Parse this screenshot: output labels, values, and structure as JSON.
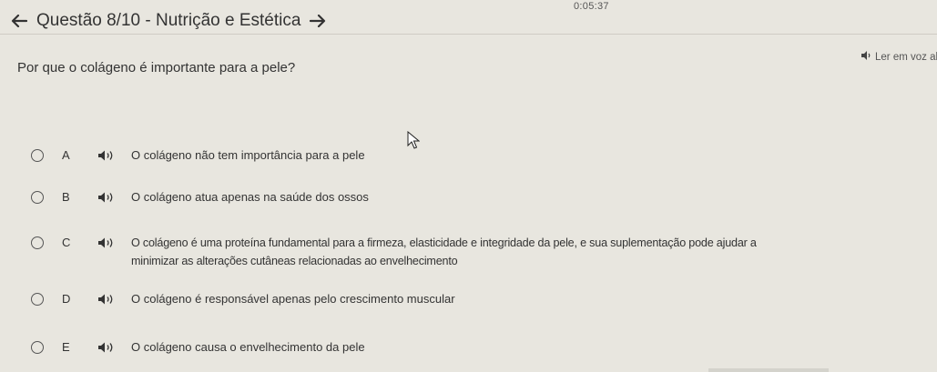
{
  "timer": "0:05:37",
  "header": {
    "title": "Questão 8/10 - Nutrição e Estética",
    "back_icon": "arrow-left-icon",
    "forward_icon": "arrow-right-icon"
  },
  "question": {
    "text": "Por que o colágeno é importante para a pele?"
  },
  "read_aloud": {
    "label": "Ler em voz alta",
    "icon": "speaker-icon"
  },
  "options": [
    {
      "letter": "A",
      "text": "O colágeno não tem importância para a pele"
    },
    {
      "letter": "B",
      "text": "O colágeno atua apenas na saúde dos ossos"
    },
    {
      "letter": "C",
      "text": "O colágeno é uma proteína fundamental para a firmeza, elasticidade e integridade da pele, e sua suplementação pode ajudar a minimizar as alterações cutâneas relacionadas ao envelhecimento"
    },
    {
      "letter": "D",
      "text": "O colágeno é responsável apenas pelo crescimento muscular"
    },
    {
      "letter": "E",
      "text": "O colágeno causa o envelhecimento da pele"
    }
  ]
}
